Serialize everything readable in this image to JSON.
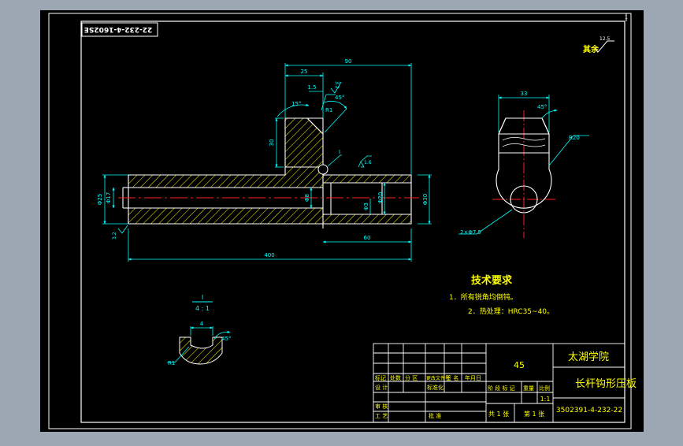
{
  "colors": {
    "background": "#9da7b4",
    "paper": "#000000",
    "frame": "#ffffff",
    "outline": "#ffffff",
    "dimension": "#00ffff",
    "hatch": "#ffff00",
    "centerline": "#ff2020",
    "note_text": "#ffff00",
    "table_text": "#ffff00",
    "table_grid": "#ffffff"
  },
  "drawing_number_rotated": "22-232-4-1602SE",
  "roughness_rest_label": "其余",
  "roughness_rest_value": "12.5",
  "dims": {
    "overall_top": "90",
    "flange_width": "25",
    "slot_depth": "1.5",
    "roughness_top": "3.2",
    "angle_left": "15°",
    "radius_r1": "R1",
    "angle_45_top": "45°",
    "detail_ref": "I",
    "roughness_right": "1.6",
    "flange_height": "30",
    "left_diameter": "Φ25",
    "bore_diameter": "Φ17",
    "inner_diameter": "Φ8",
    "step_diameter": "Φ3",
    "right_dia_1": "Φ20",
    "right_dia_2": "Φ30",
    "roughness_left": "3.2",
    "length_right": "60",
    "length_total": "400",
    "side_width": "33",
    "side_angle": "45°",
    "side_radius": "R20",
    "side_hole": "2×Φ7.5",
    "detail_label": "I",
    "detail_scale": "4 : 1",
    "detail_depth": "4",
    "detail_angle": "45°",
    "detail_radius": "R1"
  },
  "tech_title": "技术要求",
  "tech_notes": [
    "1．所有锐角均倒钝。",
    "2．热处理：HRC35~40。"
  ],
  "title_block": {
    "material": "45",
    "school": "太湖学院",
    "part_name": "长杆钩形压板",
    "drawing_no": "3502391-4-232-22",
    "scale_value": "1:1",
    "row_mark": [
      "标记",
      "处数",
      "分 区",
      "更改文件号",
      "签 名",
      "年月日"
    ],
    "row_design": [
      "设 计",
      "",
      "标准化"
    ],
    "stage_headers": [
      "阶 段 标 记",
      "重量",
      "比例"
    ],
    "row_check": "审 核",
    "row_process": "工 艺",
    "approve": "批 准",
    "total_sheets": "共 1 张",
    "sheet_no": "第 1 张"
  }
}
